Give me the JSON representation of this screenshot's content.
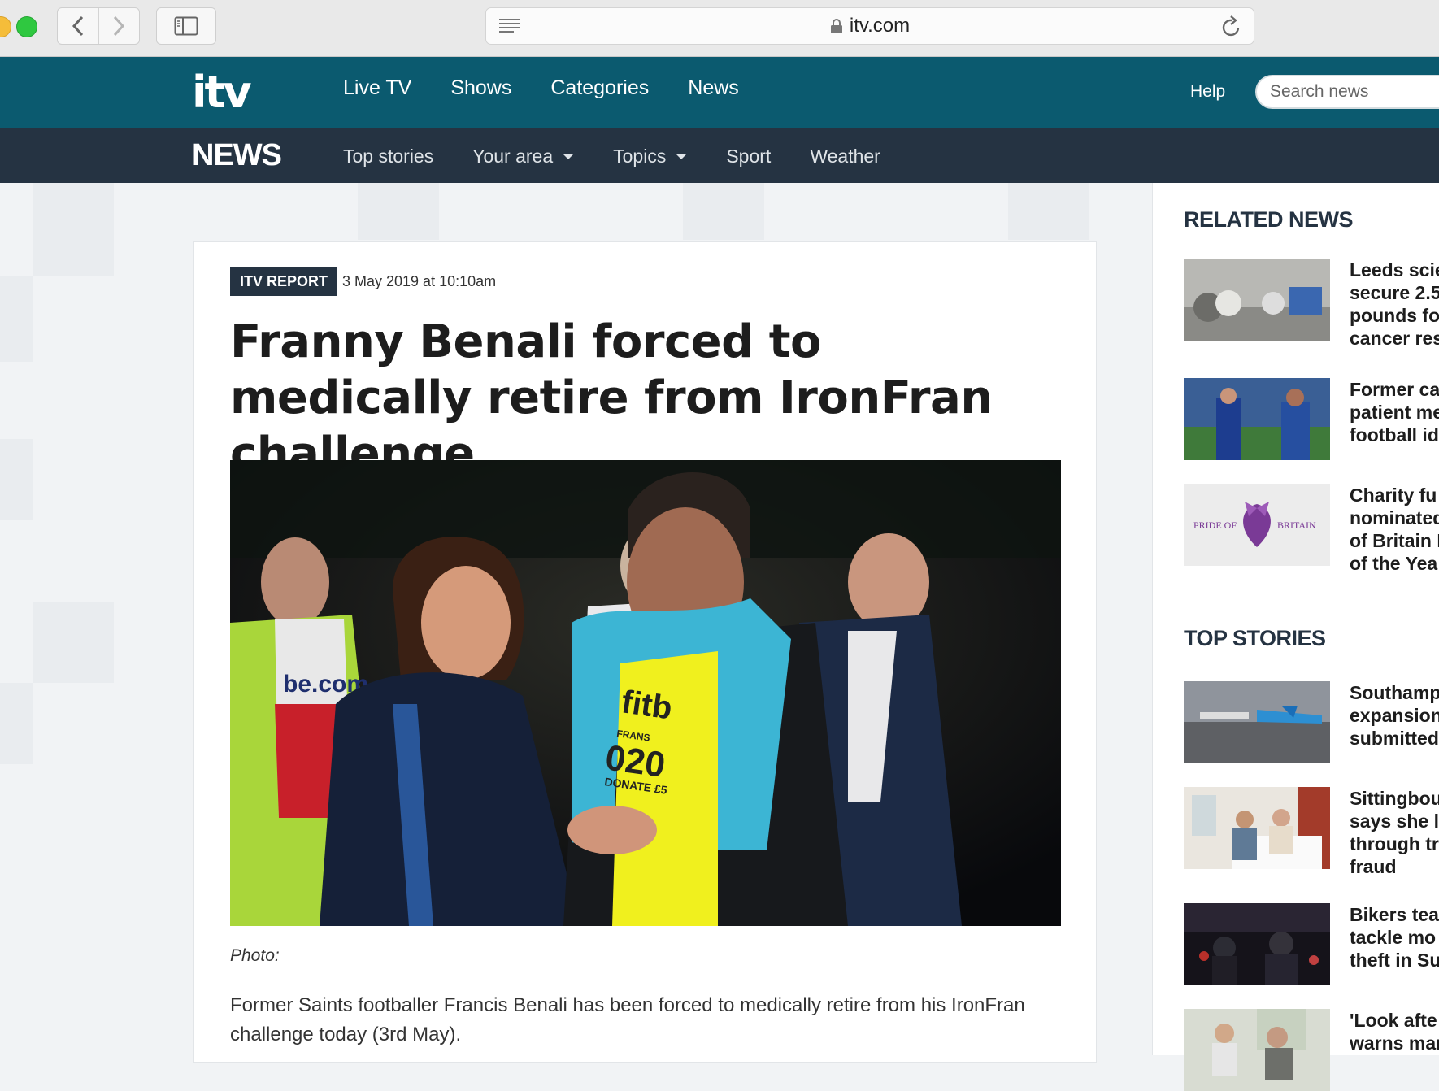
{
  "browser": {
    "url": "itv.com",
    "back_glyph": "‹",
    "forward_glyph": "›"
  },
  "header": {
    "logo": "itv",
    "nav": [
      "Live TV",
      "Shows",
      "Categories",
      "News"
    ],
    "help": "Help",
    "search_placeholder": "Search news",
    "brand_color": "#0b5a6f"
  },
  "news_nav": {
    "brand": "NEWS",
    "items": [
      {
        "label": "Top stories"
      },
      {
        "label": "Your area"
      },
      {
        "label": "Topics"
      },
      {
        "label": "Sport"
      },
      {
        "label": "Weather"
      }
    ],
    "bar_color": "#253342"
  },
  "article": {
    "badge": "ITV REPORT",
    "date": "3 May 2019 at 10:10am",
    "headline": "Franny Benali forced to medically retire from IronFran challenge",
    "photo_shirt_text": "fitb",
    "photo_shirt_number": "020",
    "photo_shirt_lines": [
      "FRANS",
      "DONATE £5"
    ],
    "photo_left_shirt_text": "be.com",
    "caption": "Photo:",
    "body": "Former Saints footballer Francis Benali has been forced to medically retire from his IronFran challenge today (3rd May)."
  },
  "sidebar": {
    "related_title": "RELATED NEWS",
    "related": [
      {
        "title_lines": [
          "Leeds scie",
          "secure 2.5",
          "pounds fo",
          "cancer res"
        ],
        "thumb": "lab-samples"
      },
      {
        "title_lines": [
          "Former ca",
          "patient me",
          "football id"
        ],
        "thumb": "stadium-pitch"
      },
      {
        "title_lines": [
          "Charity fu",
          "nominated",
          "of Britain F",
          "of the Yea"
        ],
        "thumb": "pride-of-britain-logo",
        "logo_left": "PRIDE OF",
        "logo_right": "BRITAIN"
      }
    ],
    "top_title": "TOP STORIES",
    "top": [
      {
        "title_lines": [
          "Southamp",
          "expansion",
          "submitted"
        ],
        "thumb": "airport"
      },
      {
        "title_lines": [
          "Sittingbou",
          "says she lo",
          "through tr",
          "fraud"
        ],
        "thumb": "office-women"
      },
      {
        "title_lines": [
          "Bikers tea",
          "tackle mo",
          "theft in Su"
        ],
        "thumb": "bikers-night"
      },
      {
        "title_lines": [
          "'Look afte",
          "warns mar"
        ],
        "thumb": "kitchen-people"
      }
    ]
  }
}
